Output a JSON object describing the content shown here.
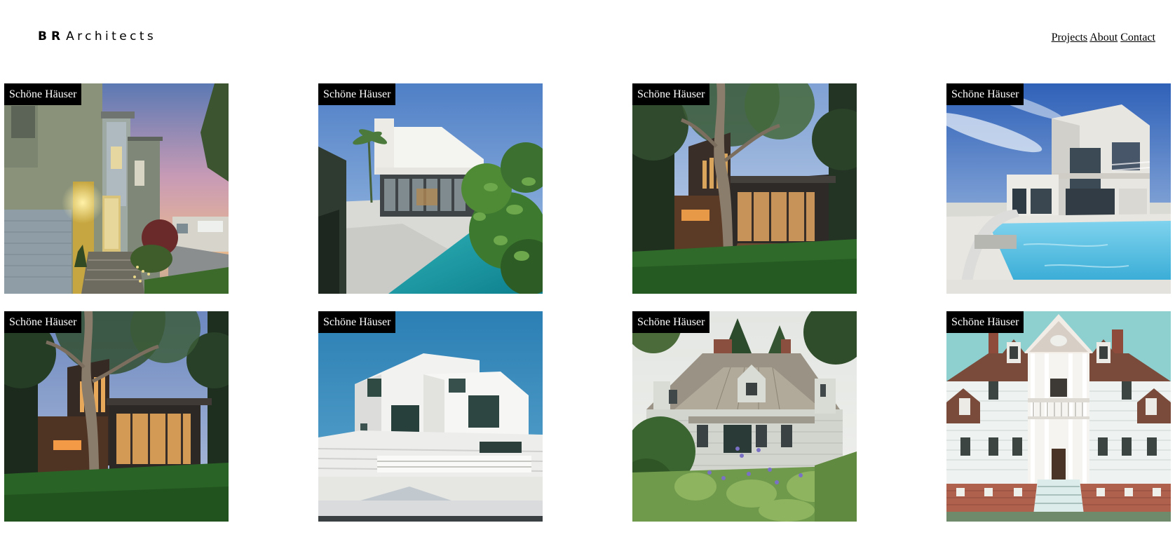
{
  "header": {
    "logo_bold": "BR",
    "logo_light": "Architects"
  },
  "nav": {
    "projects": "Projects",
    "about": "About",
    "contact": "Contact"
  },
  "projects": [
    {
      "label": "Schöne Häuser",
      "scene": "modern-house-dusk-porch"
    },
    {
      "label": "Schöne Häuser",
      "scene": "white-villa-pool-palm"
    },
    {
      "label": "Schöne Häuser",
      "scene": "wood-glass-house-tree"
    },
    {
      "label": "Schöne Häuser",
      "scene": "white-villa-blue-pool"
    },
    {
      "label": "Schöne Häuser",
      "scene": "wood-glass-house-tree-evening"
    },
    {
      "label": "Schöne Häuser",
      "scene": "white-cubic-house-blue-sky"
    },
    {
      "label": "Schöne Häuser",
      "scene": "grey-cottage-garden"
    },
    {
      "label": "Schöne Häuser",
      "scene": "colonial-white-house-porch"
    }
  ],
  "colors": {
    "label_bg": "#000000",
    "label_text": "#ffffff",
    "background": "#ffffff"
  }
}
